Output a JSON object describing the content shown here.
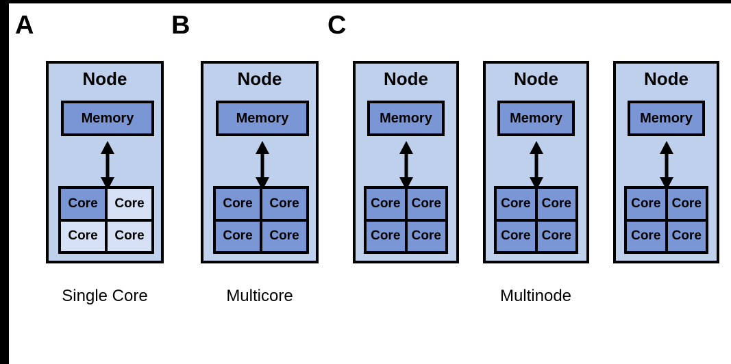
{
  "figure": {
    "background_color": "#ffffff",
    "edge_band_color": "#000000",
    "colors": {
      "node_fill": "#bfd0ed",
      "memory_fill": "#7b96d4",
      "core_active_fill": "#7b96d4",
      "core_inactive_fill": "#d6e1f5",
      "stroke": "#000000"
    }
  },
  "panels": [
    {
      "letter": "A",
      "caption": "Single Core",
      "nodes": [
        {
          "title": "Node",
          "memory_label": "Memory",
          "arrow": "double-headed-vertical-arrow",
          "cores": [
            {
              "label": "Core",
              "active": true
            },
            {
              "label": "Core",
              "active": false
            },
            {
              "label": "Core",
              "active": false
            },
            {
              "label": "Core",
              "active": false
            }
          ]
        }
      ]
    },
    {
      "letter": "B",
      "caption": "Multicore",
      "nodes": [
        {
          "title": "Node",
          "memory_label": "Memory",
          "arrow": "double-headed-vertical-arrow",
          "cores": [
            {
              "label": "Core",
              "active": true
            },
            {
              "label": "Core",
              "active": true
            },
            {
              "label": "Core",
              "active": true
            },
            {
              "label": "Core",
              "active": true
            }
          ]
        }
      ]
    },
    {
      "letter": "C",
      "caption": "Multinode",
      "nodes": [
        {
          "title": "Node",
          "memory_label": "Memory",
          "arrow": "double-headed-vertical-arrow",
          "cores": [
            {
              "label": "Core",
              "active": true
            },
            {
              "label": "Core",
              "active": true
            },
            {
              "label": "Core",
              "active": true
            },
            {
              "label": "Core",
              "active": true
            }
          ]
        },
        {
          "title": "Node",
          "memory_label": "Memory",
          "arrow": "double-headed-vertical-arrow",
          "cores": [
            {
              "label": "Core",
              "active": true
            },
            {
              "label": "Core",
              "active": true
            },
            {
              "label": "Core",
              "active": true
            },
            {
              "label": "Core",
              "active": true
            }
          ]
        },
        {
          "title": "Node",
          "memory_label": "Memory",
          "arrow": "double-headed-vertical-arrow",
          "cores": [
            {
              "label": "Core",
              "active": true
            },
            {
              "label": "Core",
              "active": true
            },
            {
              "label": "Core",
              "active": true
            },
            {
              "label": "Core",
              "active": true
            }
          ]
        }
      ]
    }
  ]
}
